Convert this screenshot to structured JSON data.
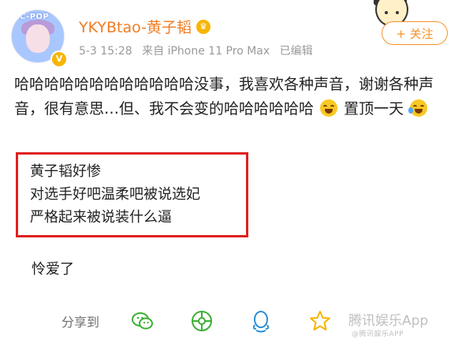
{
  "header": {
    "avatar_tag": "C-POP",
    "username": "YKYBtao-黄子韬",
    "timestamp": "5-3 15:28",
    "source": "来自 iPhone 11 Pro Max",
    "edited": "已编辑",
    "follow_label": "+ 关注"
  },
  "post": {
    "text_part1": "哈哈哈哈哈哈哈哈哈哈哈哈没事，我喜欢各种声音，谢谢各种声音，很有意思…但、我不会变的哈哈哈哈哈哈",
    "text_part2": "置顶一天"
  },
  "highlight": {
    "lines": [
      "黄子韬好惨",
      "对选手好吧温柔吧被说选妃",
      "严格起来被说装什么逼"
    ]
  },
  "reply": {
    "text": "怜爱了"
  },
  "share": {
    "label": "分享到",
    "targets": [
      "wechat-icon",
      "moments-icon",
      "qq-icon",
      "qzone-icon"
    ]
  },
  "watermark": {
    "main": "腾讯娱乐App",
    "sub": "@腾讯娱乐APP"
  },
  "colors": {
    "accent": "#f7932a",
    "username": "#f07c22",
    "highlight_border": "#e02020"
  }
}
